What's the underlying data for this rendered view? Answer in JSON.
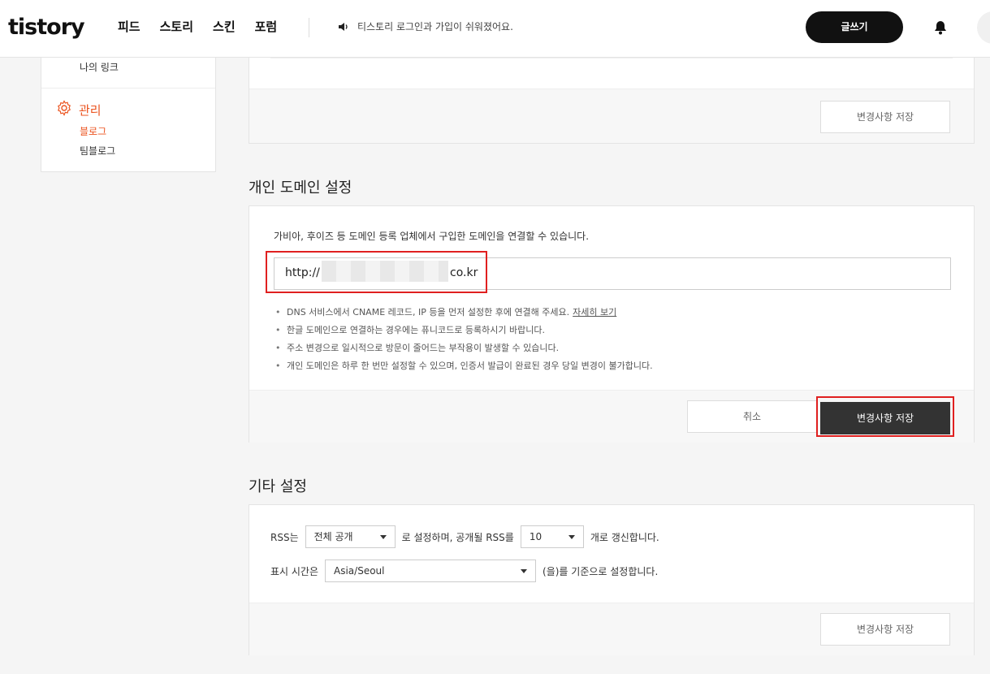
{
  "header": {
    "logo": "tistory",
    "nav": [
      "피드",
      "스토리",
      "스킨",
      "포럼"
    ],
    "notice": "티스토리 로그인과 가입이 쉬워졌어요.",
    "write_button": "글쓰기",
    "icons": {
      "notice": "speaker-icon",
      "bell": "bell-icon"
    }
  },
  "sidebar": {
    "link_item": "나의 링크",
    "manage_label": "관리",
    "manage_items": [
      "블로그",
      "팀블로그"
    ],
    "accent_color": "#eb531f"
  },
  "top_panel": {
    "save_label": "변경사항 저장"
  },
  "domain": {
    "title": "개인 도메인 설정",
    "description": "가비아, 후이즈 등 도메인 등록 업체에서 구입한 도메인을 연결할 수 있습니다.",
    "prefix": "http://",
    "suffix": "co.kr",
    "notes": [
      "DNS 서비스에서 CNAME 레코드, IP 등을 먼저 설정한 후에 연결해 주세요.",
      "한글 도메인으로 연결하는 경우에는 퓨니코드로 등록하시기 바랍니다.",
      "주소 변경으로 일시적으로 방문이 줄어드는 부작용이 발생할 수 있습니다.",
      "개인 도메인은 하루 한 번만 설정할 수 있으며, 인증서 발급이 완료된 경우 당일 변경이 불가합니다."
    ],
    "detail_link": "자세히 보기",
    "cancel_label": "취소",
    "save_label": "변경사항 저장",
    "highlight_color": "#e02020"
  },
  "etc": {
    "title": "기타 설정",
    "rss_prefix": "RSS는",
    "rss_select": "전체 공개",
    "rss_middle": "로 설정하며, 공개될 RSS를",
    "rss_count": "10",
    "rss_suffix": "개로 갱신합니다.",
    "time_prefix": "표시 시간은",
    "timezone": "Asia/Seoul",
    "time_suffix": "(을)를 기준으로 설정합니다.",
    "save_label": "변경사항 저장"
  }
}
